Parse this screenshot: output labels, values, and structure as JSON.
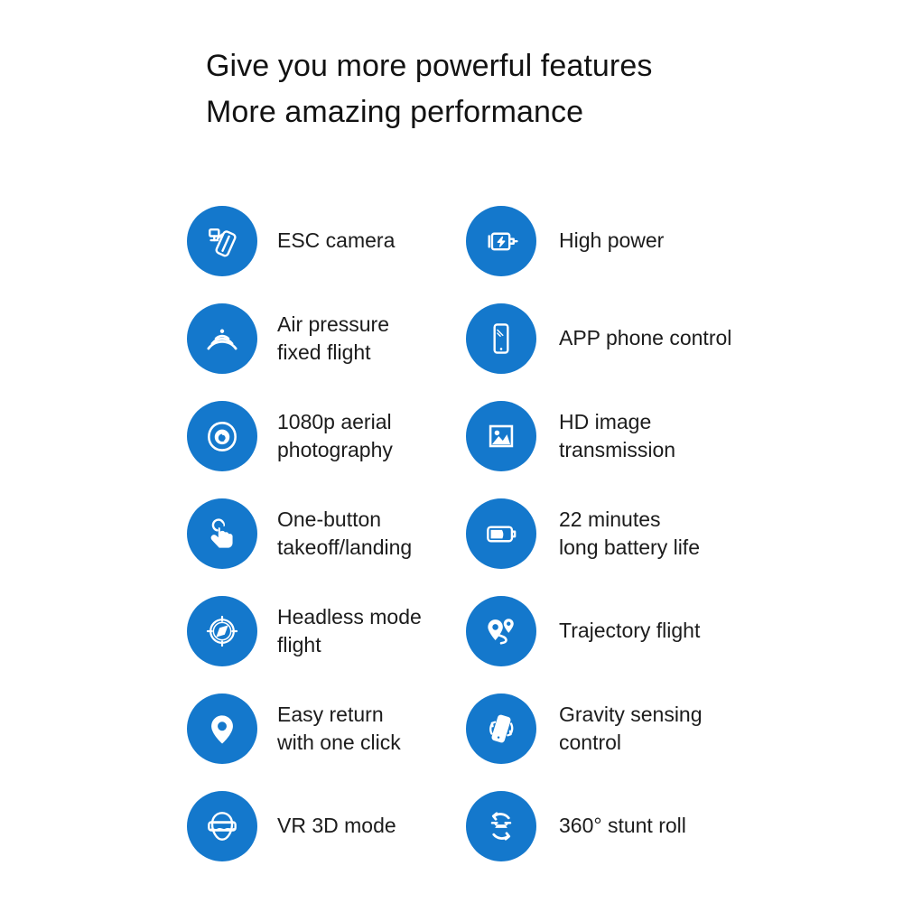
{
  "headline": {
    "line1": "Give you more powerful features",
    "line2": "More amazing performance"
  },
  "theme": {
    "accent_blue": "#1478CC",
    "icon_color": "#FFFFFF",
    "background": "#FFFFFF",
    "text_color": "#1C1C1C"
  },
  "features": {
    "rows": [
      {
        "left": {
          "icon": "esc-camera-icon",
          "label": "ESC camera"
        },
        "right": {
          "icon": "motor-power-icon",
          "label": "High power"
        }
      },
      {
        "left": {
          "icon": "air-pressure-icon",
          "label": "Air pressure\nfixed flight"
        },
        "right": {
          "icon": "smartphone-icon",
          "label": "APP phone control"
        }
      },
      {
        "left": {
          "icon": "camera-lens-icon",
          "label": "1080p aerial\nphotography"
        },
        "right": {
          "icon": "image-picture-icon",
          "label": "HD image\ntransmission"
        }
      },
      {
        "left": {
          "icon": "touch-hand-icon",
          "label": "One-button\ntakeoff/landing"
        },
        "right": {
          "icon": "battery-icon",
          "label": "22 minutes\nlong battery life"
        }
      },
      {
        "left": {
          "icon": "compass-icon",
          "label": "Headless mode\nflight"
        },
        "right": {
          "icon": "waypoint-route-icon",
          "label": "Trajectory flight"
        }
      },
      {
        "left": {
          "icon": "map-pin-icon",
          "label": "Easy return\nwith one click"
        },
        "right": {
          "icon": "tilt-phone-icon",
          "label": "Gravity sensing\ncontrol"
        }
      },
      {
        "left": {
          "icon": "vr-headset-icon",
          "label": "VR 3D mode"
        },
        "right": {
          "icon": "drone-flip-icon",
          "label": "360° stunt roll"
        }
      }
    ]
  }
}
